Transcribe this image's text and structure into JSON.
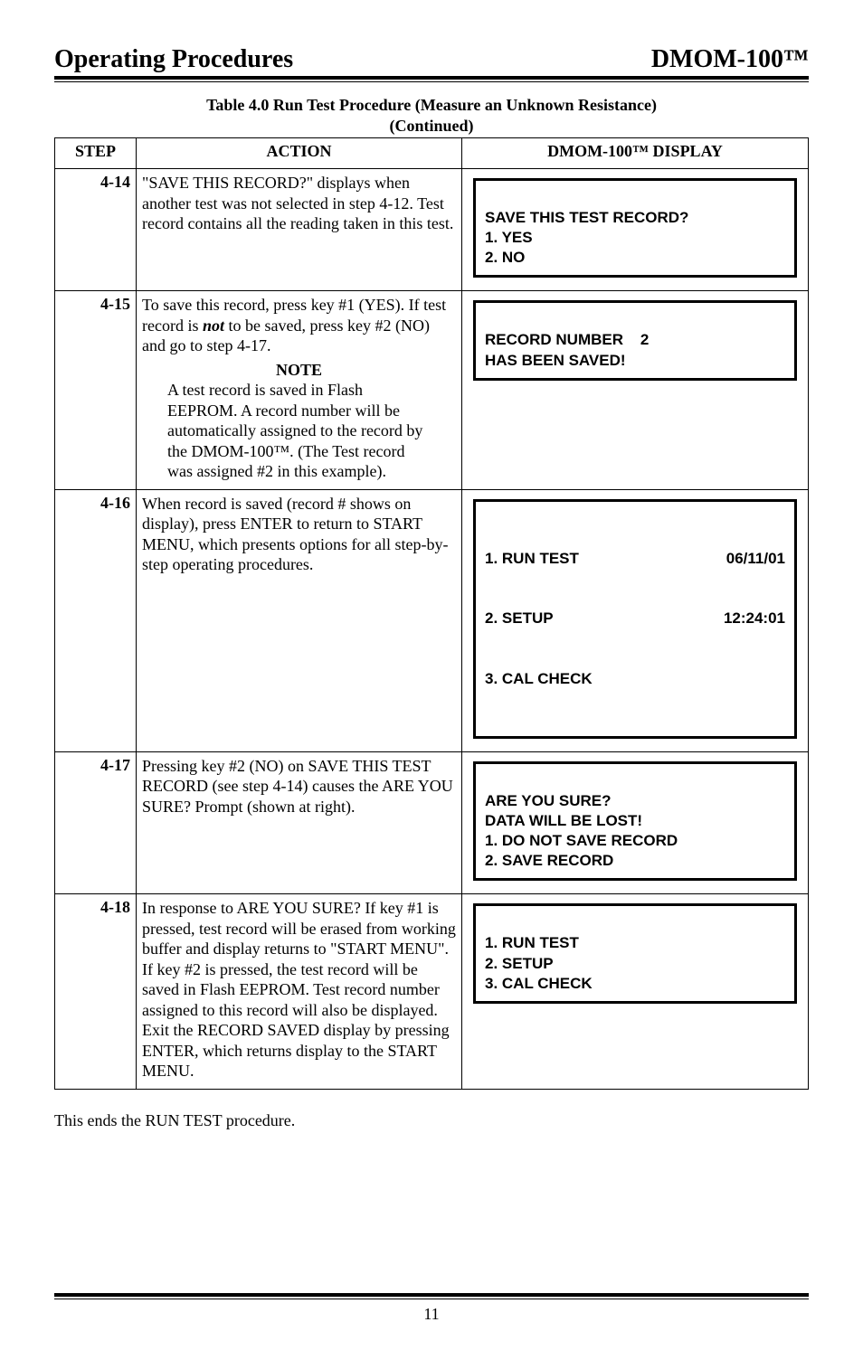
{
  "header": {
    "left": "Operating Procedures",
    "right": "DMOM-100™"
  },
  "caption": {
    "line1": "Table 4.0   Run Test Procedure (Measure an Unknown Resistance)",
    "line2": "(Continued)"
  },
  "columns": {
    "step": "STEP",
    "action": "ACTION",
    "display": "DMOM-100™ DISPLAY"
  },
  "rows": [
    {
      "step": "4-14",
      "action_html": "\"SAVE THIS RECORD?\" displays when another test was not selected in step 4-12. Test record contains all the reading taken in this test.",
      "display_lines": [
        "SAVE THIS TEST RECORD?",
        "1. YES",
        "2. NO"
      ]
    },
    {
      "step": "4-15",
      "action_intro": "To save this record, press key #1 (YES).  If test record is ",
      "action_not": "not",
      "action_after": " to be saved, press key #2 (NO) and go to step 4-17.",
      "note_heading": "NOTE",
      "note_body": "A test record is saved in Flash EEPROM.  A record number will be automatically assigned to the record by the DMOM-100™. (The Test record was assigned #2 in this example).",
      "display_lines": [
        "RECORD NUMBER    2",
        "HAS BEEN SAVED!"
      ]
    },
    {
      "step": "4-16",
      "action_html": "When record is saved (record # shows on display), press ENTER to return to START MENU, which presents options for all step-by-step operating procedures.",
      "display_menu_left": [
        "1. RUN TEST",
        "2. SETUP",
        "3. CAL CHECK"
      ],
      "display_menu_right": [
        "06/11/01",
        "12:24:01",
        ""
      ]
    },
    {
      "step": "4-17",
      "action_html": "Pressing key #2 (NO) on SAVE THIS TEST RECORD (see step 4-14) causes the ARE YOU SURE?  Prompt (shown at right).",
      "display_lines": [
        "ARE YOU SURE?",
        "DATA WILL BE LOST!",
        "1. DO NOT SAVE RECORD",
        "2. SAVE RECORD"
      ]
    },
    {
      "step": "4-18",
      "action_html": "In response to ARE YOU SURE?  If key #1 is pressed, test record will be erased from working buffer and display returns to \"START MENU\".  If key #2 is pressed, the test record will be saved in Flash EEPROM.  Test record number assigned to this record will also be displayed. Exit the RECORD SAVED display by pressing ENTER, which returns display to the START MENU.",
      "display_lines": [
        "1. RUN TEST",
        "2. SETUP",
        "3. CAL CHECK"
      ]
    }
  ],
  "closing": "This ends the RUN TEST procedure.",
  "page_number": "11"
}
